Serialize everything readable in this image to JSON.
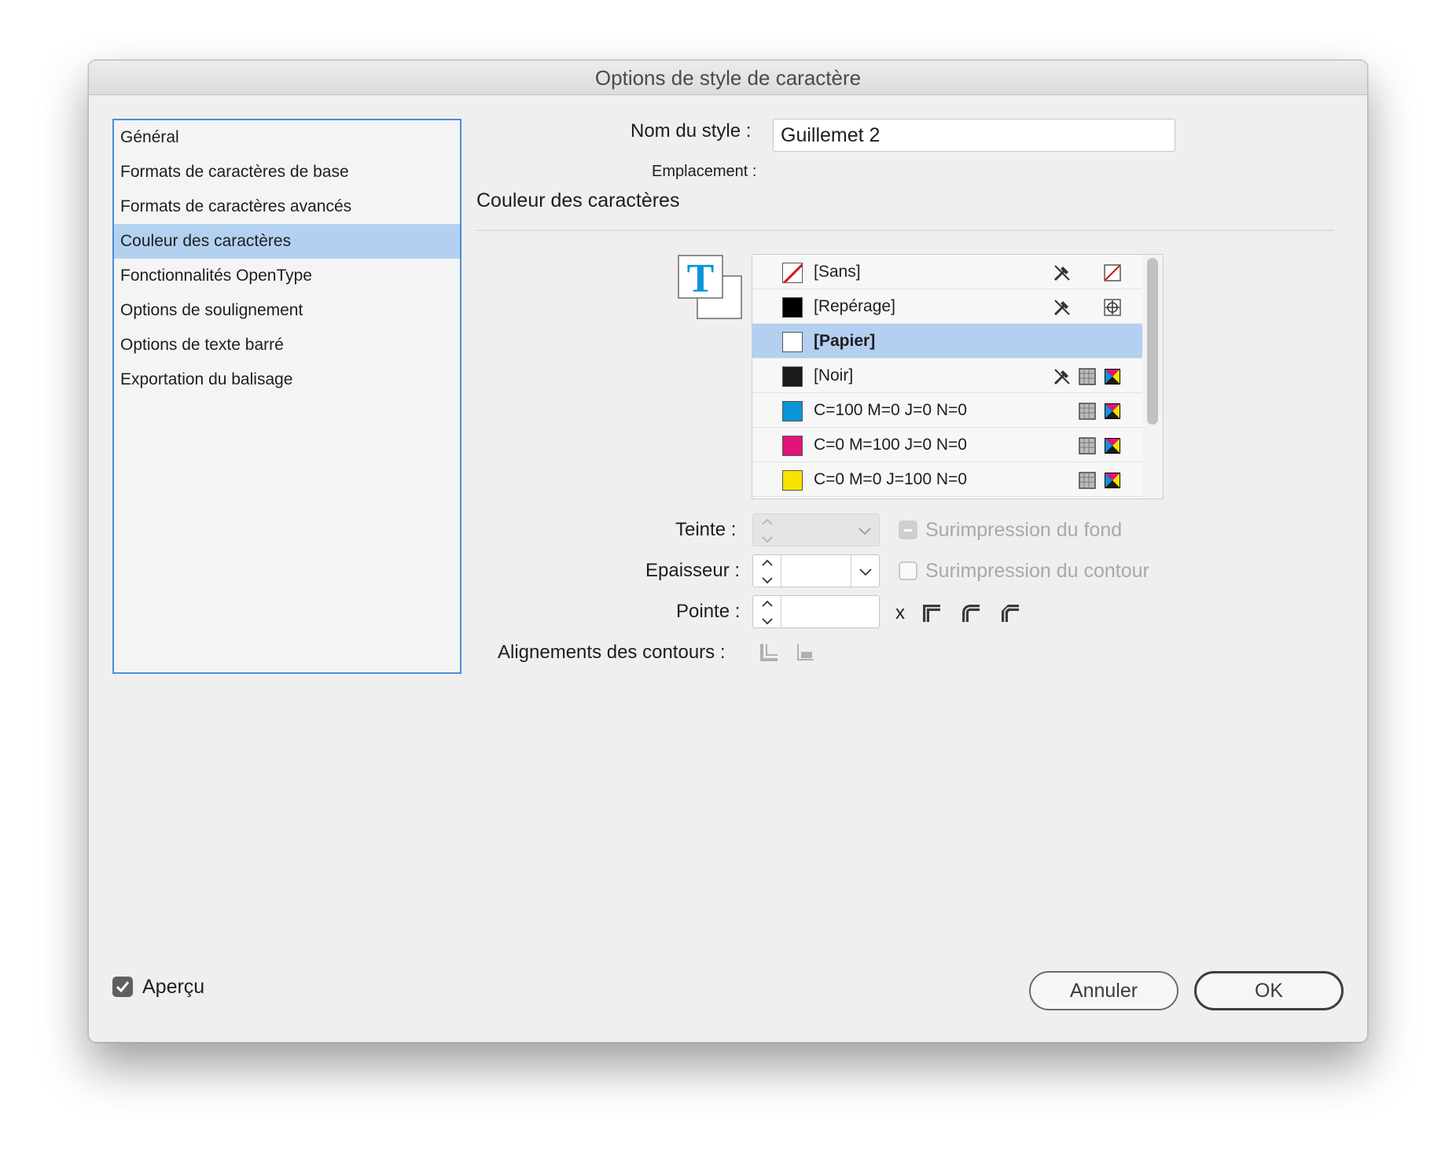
{
  "window": {
    "title": "Options de style de caractère"
  },
  "categories": [
    {
      "label": "Général",
      "selected": false
    },
    {
      "label": "Formats de caractères de base",
      "selected": false
    },
    {
      "label": "Formats de caractères avancés",
      "selected": false
    },
    {
      "label": "Couleur des caractères",
      "selected": true
    },
    {
      "label": "Fonctionnalités OpenType",
      "selected": false
    },
    {
      "label": "Options de soulignement",
      "selected": false
    },
    {
      "label": "Options de texte barré",
      "selected": false
    },
    {
      "label": "Exportation du balisage",
      "selected": false
    }
  ],
  "style_name": {
    "label": "Nom du style :",
    "value": "Guillemet 2"
  },
  "location": {
    "label": "Emplacement :"
  },
  "section_title": "Couleur des caractères",
  "swatches": [
    {
      "name": "[Sans]",
      "color": "#ffffff",
      "icons": [
        "no-edit-icon",
        "none-swatch-icon"
      ]
    },
    {
      "name": "[Repérage]",
      "color": "#000000",
      "icons": [
        "no-edit-icon",
        "registration-icon"
      ]
    },
    {
      "name": "[Papier]",
      "color": "#ffffff",
      "selected": true,
      "icons": []
    },
    {
      "name": "[Noir]",
      "color": "#1a1a1a",
      "icons": [
        "no-edit-icon",
        "process-color-icon",
        "cmyk-icon"
      ]
    },
    {
      "name": "C=100 M=0 J=0 N=0",
      "color": "#0a94d8",
      "icons": [
        "process-color-icon",
        "cmyk-icon"
      ]
    },
    {
      "name": "C=0 M=100 J=0 N=0",
      "color": "#e2127a",
      "icons": [
        "process-color-icon",
        "cmyk-icon"
      ]
    },
    {
      "name": "C=0 M=0 J=100 N=0",
      "color": "#f7e300",
      "icons": [
        "process-color-icon",
        "cmyk-icon"
      ]
    }
  ],
  "fields": {
    "tint_label": "Teinte :",
    "weight_label": "Epaisseur :",
    "miter_label": "Pointe :",
    "miter_x": "x",
    "stroke_align_label": "Alignements des contours :"
  },
  "overprint": {
    "fill_label": "Surimpression du fond",
    "stroke_label": "Surimpression du contour"
  },
  "preview": {
    "label": "Aperçu",
    "checked": true
  },
  "buttons": {
    "cancel": "Annuler",
    "ok": "OK"
  },
  "colors": {
    "accent": "#4a8ed9",
    "selection": "#b4d0f1",
    "t_icon": "#0a94d8"
  }
}
